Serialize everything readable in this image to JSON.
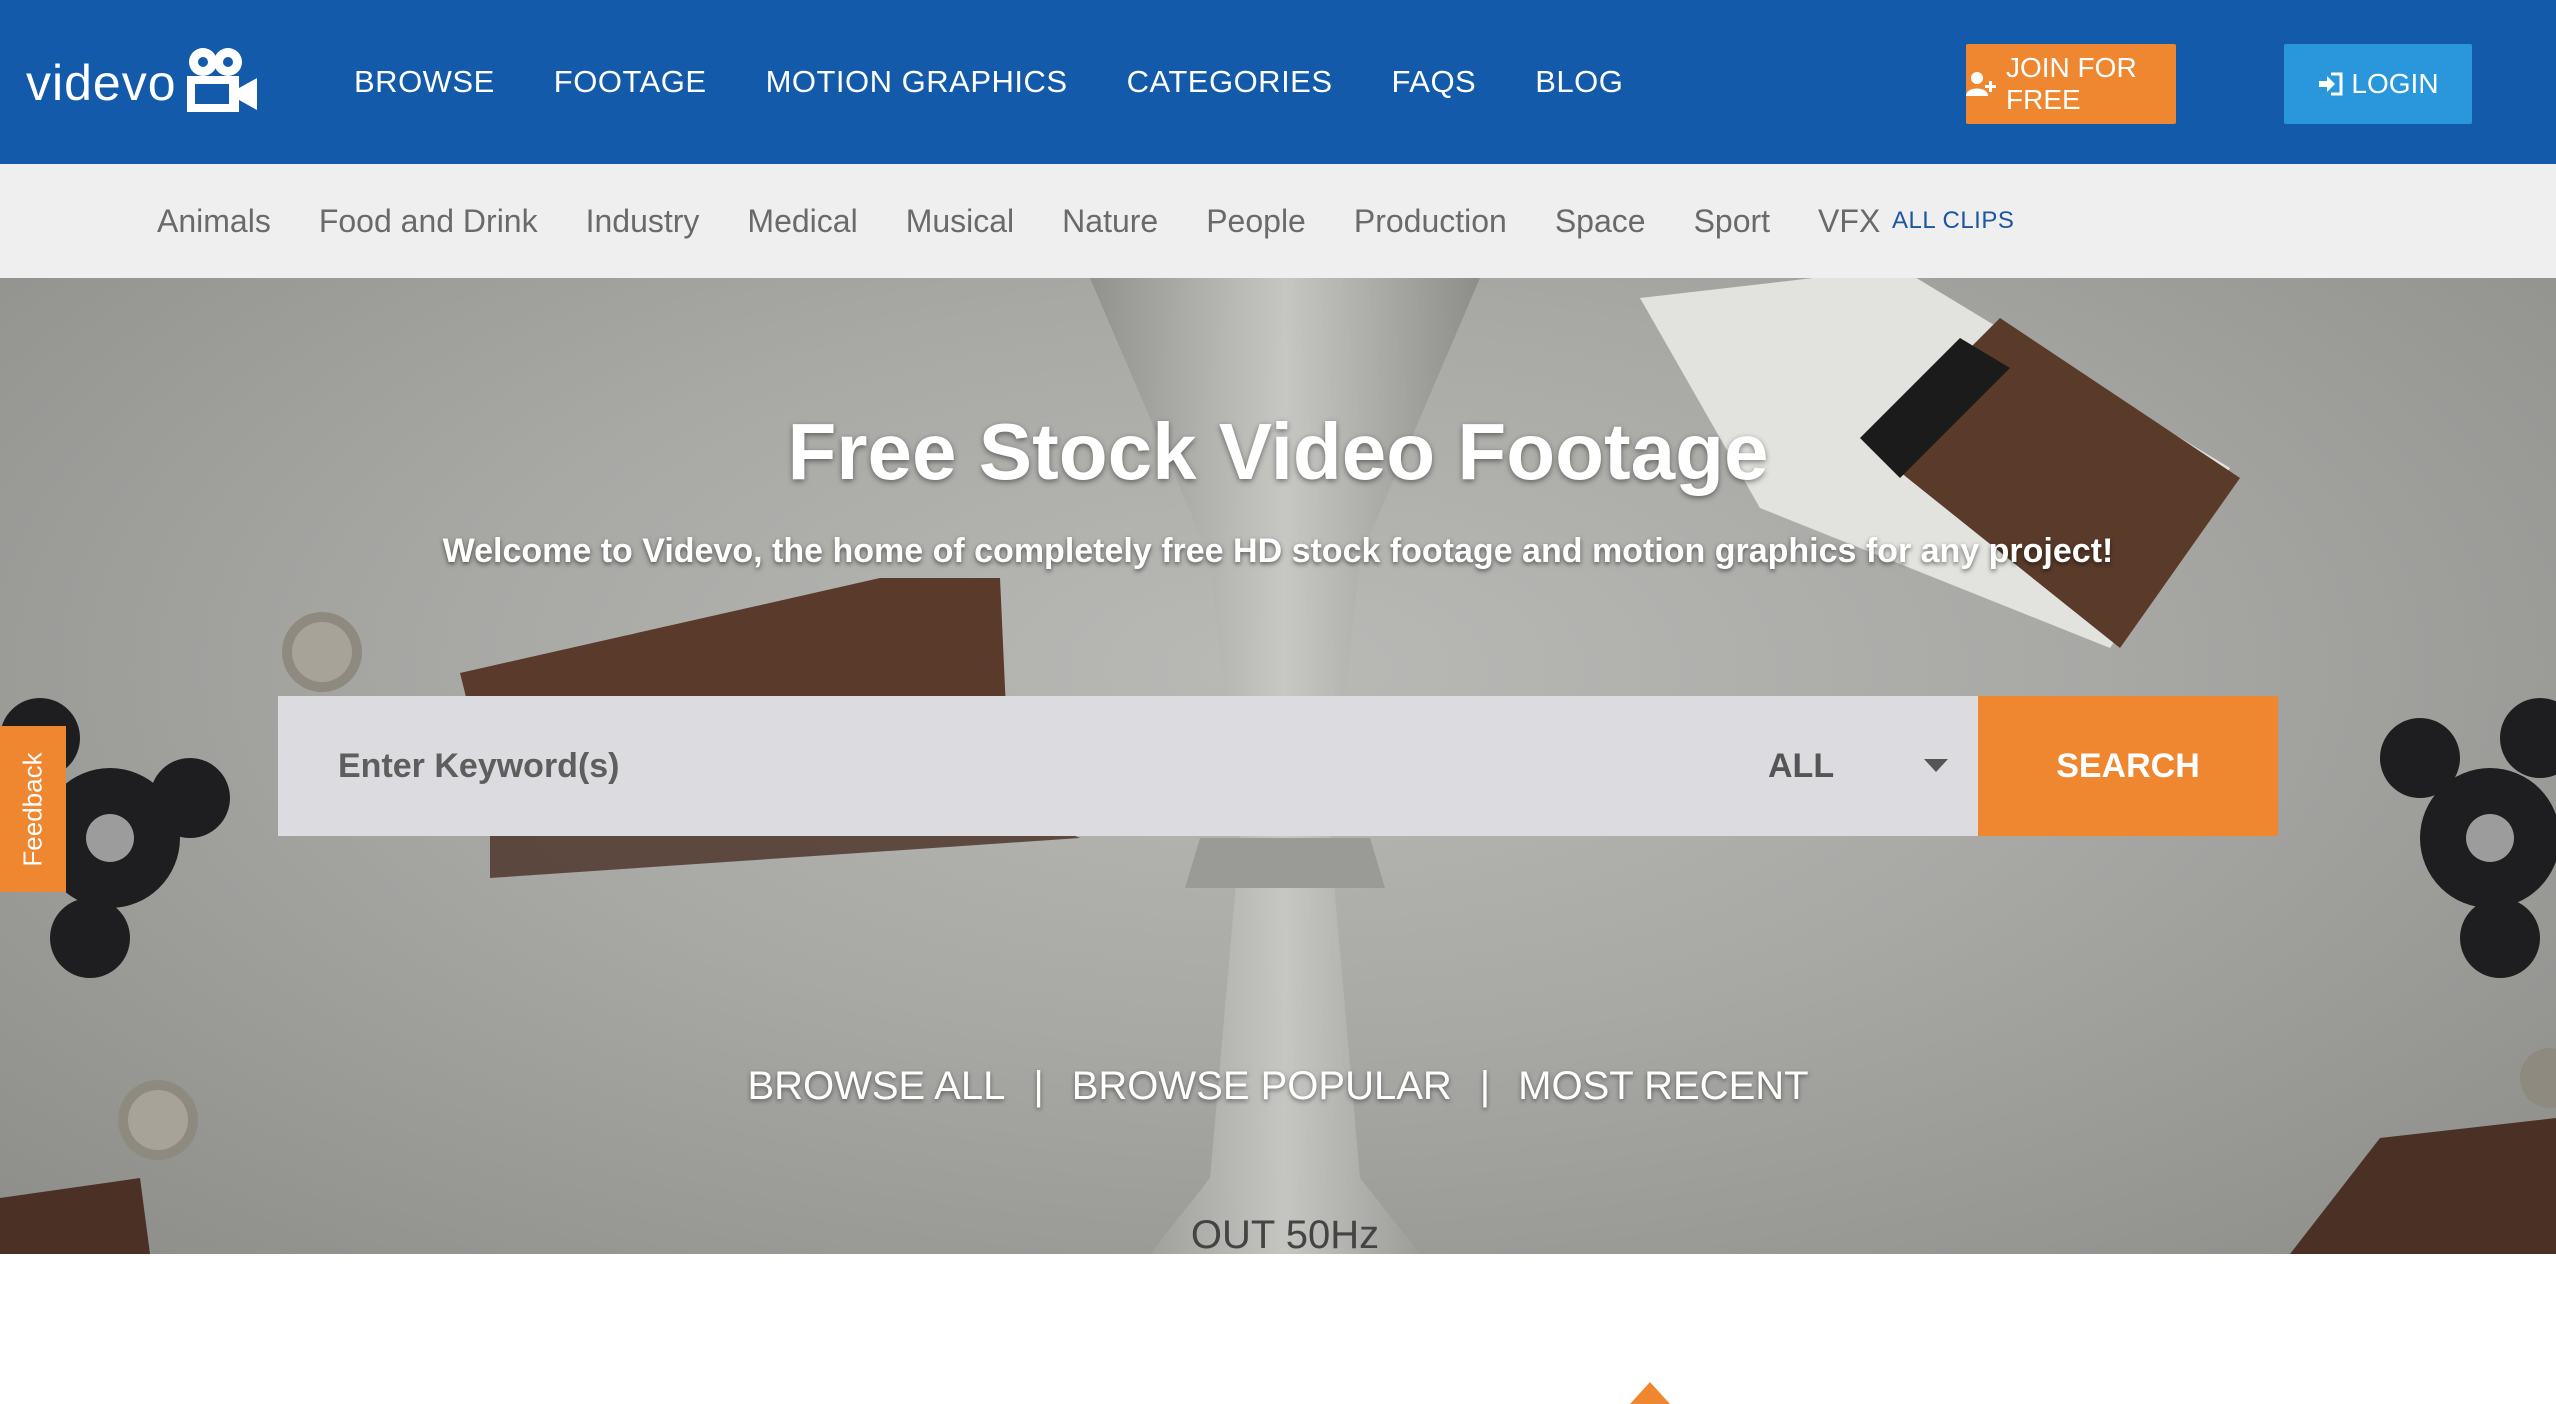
{
  "brand": {
    "name": "videvo"
  },
  "nav": {
    "items": [
      "BROWSE",
      "FOOTAGE",
      "MOTION GRAPHICS",
      "CATEGORIES",
      "FAQS",
      "BLOG"
    ],
    "join_label": "JOIN FOR FREE",
    "login_label": "LOGIN"
  },
  "categories": {
    "items": [
      "Animals",
      "Food and Drink",
      "Industry",
      "Medical",
      "Musical",
      "Nature",
      "People",
      "Production",
      "Space",
      "Sport",
      "VFX"
    ],
    "all_clips": "ALL CLIPS"
  },
  "hero": {
    "title": "Free Stock Video Footage",
    "subtitle": "Welcome to Videvo, the home of completely free HD stock footage and motion graphics for any project!",
    "reel_text": "OUT 50Hz"
  },
  "search": {
    "placeholder": "Enter Keyword(s)",
    "filter_value": "ALL",
    "button_label": "SEARCH"
  },
  "browse_links": {
    "all": "BROWSE ALL",
    "popular": "BROWSE POPULAR",
    "recent": "MOST RECENT",
    "separator": "|"
  },
  "feedback": {
    "label": "Feedback"
  },
  "colors": {
    "nav_blue": "#135baa",
    "accent_orange": "#ee8730",
    "login_blue": "#2a97dd",
    "category_bar": "#efefef"
  },
  "icons": [
    "camera-logo-icon",
    "user-plus-icon",
    "sign-in-icon",
    "caret-down-icon"
  ]
}
